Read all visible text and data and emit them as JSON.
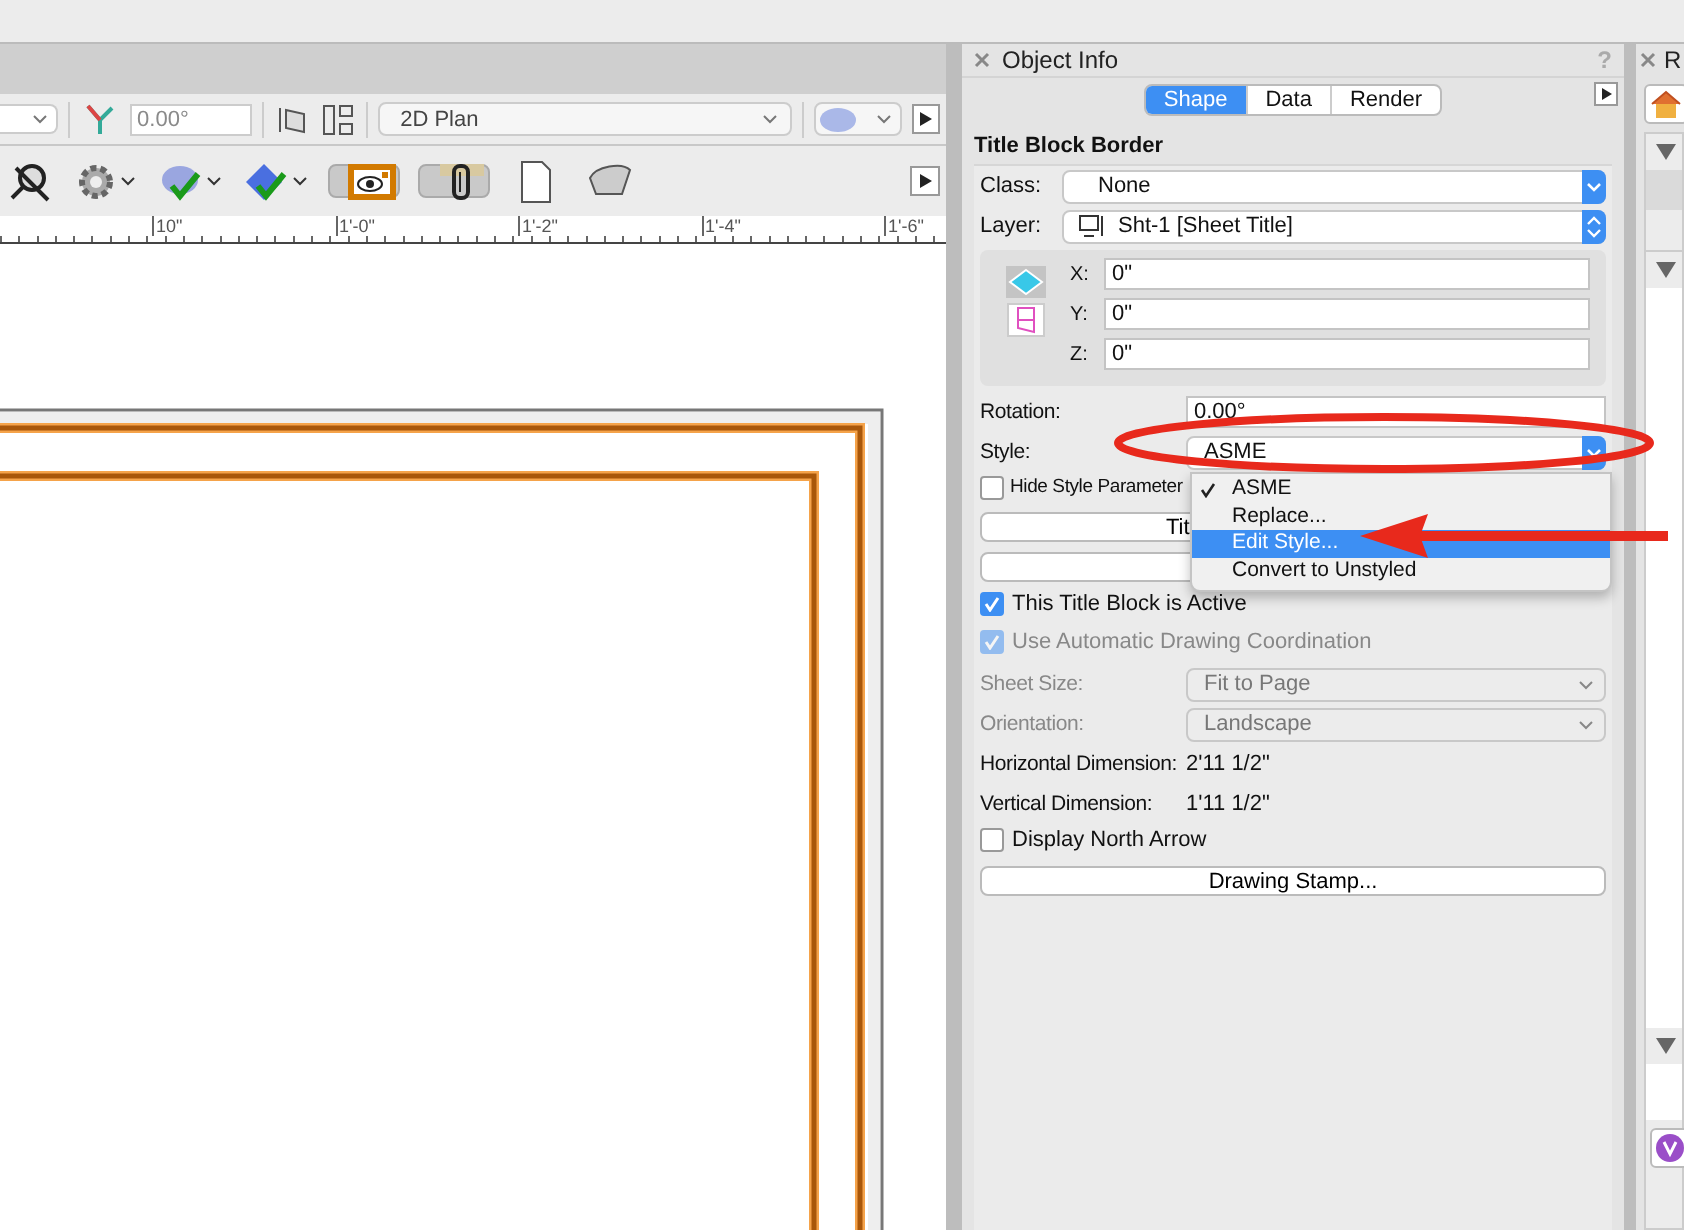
{
  "toolbar_top": {
    "angle_field": {
      "value": "0.00°",
      "disabled": true
    },
    "view_dropdown": {
      "value": "2D Plan"
    }
  },
  "toolbar_tools": [
    {
      "kind": "zoom",
      "caret": false,
      "selected": false
    },
    {
      "kind": "gear",
      "caret": true,
      "selected": false
    },
    {
      "kind": "teapot",
      "caret": true,
      "selected": false
    },
    {
      "kind": "globe",
      "caret": true,
      "selected": false
    },
    {
      "kind": "eye",
      "caret": false,
      "selected": true
    },
    {
      "kind": "link",
      "caret": false,
      "selected": true
    },
    {
      "kind": "page",
      "caret": false,
      "selected": false
    },
    {
      "kind": "render",
      "caret": false,
      "selected": false
    }
  ],
  "ruler": {
    "labels": [
      "10\"",
      "1'-0\"",
      "1'-2\"",
      "1'-4\"",
      "1'-6\""
    ]
  },
  "object_info": {
    "title": "Object Info",
    "help": "?",
    "tabs": [
      {
        "label": "Shape",
        "selected": true
      },
      {
        "label": "Data",
        "selected": false
      },
      {
        "label": "Render",
        "selected": false
      }
    ],
    "heading": "Title Block Border",
    "class": {
      "label": "Class:",
      "value": "None"
    },
    "layer": {
      "label": "Layer:",
      "value": "Sht-1 [Sheet Title]"
    },
    "coordinates": [
      {
        "label": "X:",
        "value": "0\""
      },
      {
        "label": "Y:",
        "value": "0\""
      },
      {
        "label": "Z:",
        "value": "0\""
      }
    ],
    "rotation": {
      "label": "Rotation:",
      "value": "0.00°"
    },
    "style": {
      "label": "Style:",
      "value": "ASME"
    },
    "hide_style_parameters": {
      "label": "Hide Style Parameter",
      "checked": false,
      "disabled": false
    },
    "title_button": "Tit",
    "active": {
      "label": "This Title Block is Active",
      "checked": true,
      "disabled": false
    },
    "auto_coordination": {
      "label": "Use Automatic Drawing Coordination",
      "checked": true,
      "disabled": true
    },
    "sheet_size": {
      "label": "Sheet Size:",
      "value": "Fit to Page",
      "disabled": true
    },
    "orientation": {
      "label": "Orientation:",
      "value": "Landscape",
      "disabled": true
    },
    "horizontal_dimension": {
      "label": "Horizontal Dimension:",
      "value": "2'11 1/2\""
    },
    "vertical_dimension": {
      "label": "Vertical Dimension:",
      "value": "1'11 1/2\""
    },
    "north_arrow": {
      "label": "Display North Arrow",
      "checked": false,
      "disabled": false
    },
    "stamp_button": "Drawing Stamp..."
  },
  "style_menu": [
    {
      "label": "ASME",
      "checked": true,
      "selected": false
    },
    {
      "label": "Replace...",
      "checked": false,
      "selected": false
    },
    {
      "label": "Edit Style...",
      "checked": false,
      "selected": true
    },
    {
      "label": "Convert to Unstyled",
      "checked": false,
      "selected": false
    }
  ],
  "right_panel": {
    "title": "R"
  }
}
